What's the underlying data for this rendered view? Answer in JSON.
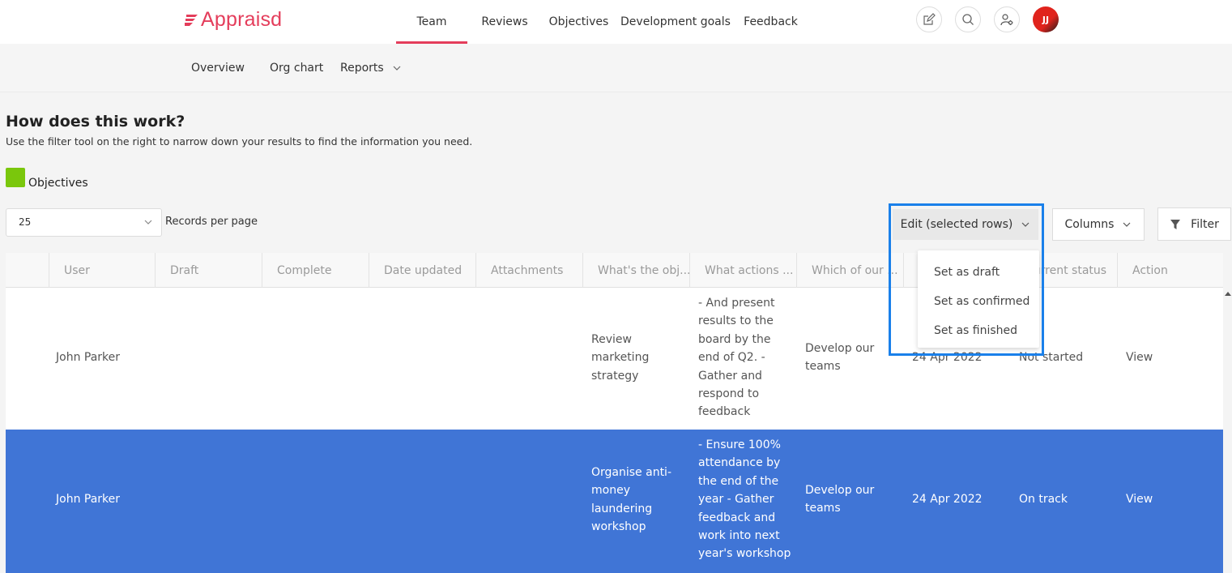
{
  "brand": {
    "name": "Appraisd",
    "color": "#e43d5b"
  },
  "main_nav": [
    {
      "label": "Team",
      "active": true
    },
    {
      "label": "Reviews"
    },
    {
      "label": "Objectives"
    },
    {
      "label": "Development goals"
    },
    {
      "label": "Feedback"
    }
  ],
  "header_icons": [
    "edit-icon",
    "search-icon",
    "user-settings-icon"
  ],
  "user": {
    "initials": "JJ"
  },
  "sub_nav": [
    {
      "label": "Overview"
    },
    {
      "label": "Org chart"
    },
    {
      "label": "Reports"
    }
  ],
  "help": {
    "title": "How does this work?",
    "text": "Use the filter tool on the right to narrow down your results to find the information you need."
  },
  "section": {
    "label": "Objectives",
    "color": "#7ac70c"
  },
  "records": {
    "value": "25",
    "label": "Records per page"
  },
  "toolbar": {
    "edit_label": "Edit (selected rows)",
    "columns_label": "Columns",
    "filter_label": "Filter"
  },
  "edit_menu": [
    "Set as draft",
    "Set as confirmed",
    "Set as finished"
  ],
  "table": {
    "columns": [
      "User",
      "Draft",
      "Complete",
      "Date updated",
      "Attachments",
      "What's the obj...",
      "What actions ...",
      "Which of our ...",
      "",
      "Current status",
      "Action"
    ],
    "rows": [
      {
        "user": "John Parker",
        "objective": [
          "Review",
          "marketing",
          "strategy"
        ],
        "actions": [
          "- And present",
          "results to the",
          "board by the",
          "end of Q2. -",
          "Gather and",
          "respond to",
          "feedback"
        ],
        "goal": [
          "Develop our",
          "teams"
        ],
        "date": "24 Apr 2022",
        "status": "Not started",
        "action": "View",
        "selected": false
      },
      {
        "user": "John Parker",
        "objective": [
          "Organise anti-",
          "money",
          "laundering",
          "workshop"
        ],
        "actions": [
          "- Ensure 100%",
          "attendance by",
          "the end of the",
          "year - Gather",
          "feedback and",
          "work into next",
          "year's workshop"
        ],
        "goal": [
          "Develop our",
          "teams"
        ],
        "date": "24 Apr 2022",
        "status": "On track",
        "action": "View",
        "selected": true
      }
    ]
  },
  "colors": {
    "selected_row": "#4075d6",
    "highlight_border": "#1a80ea"
  }
}
